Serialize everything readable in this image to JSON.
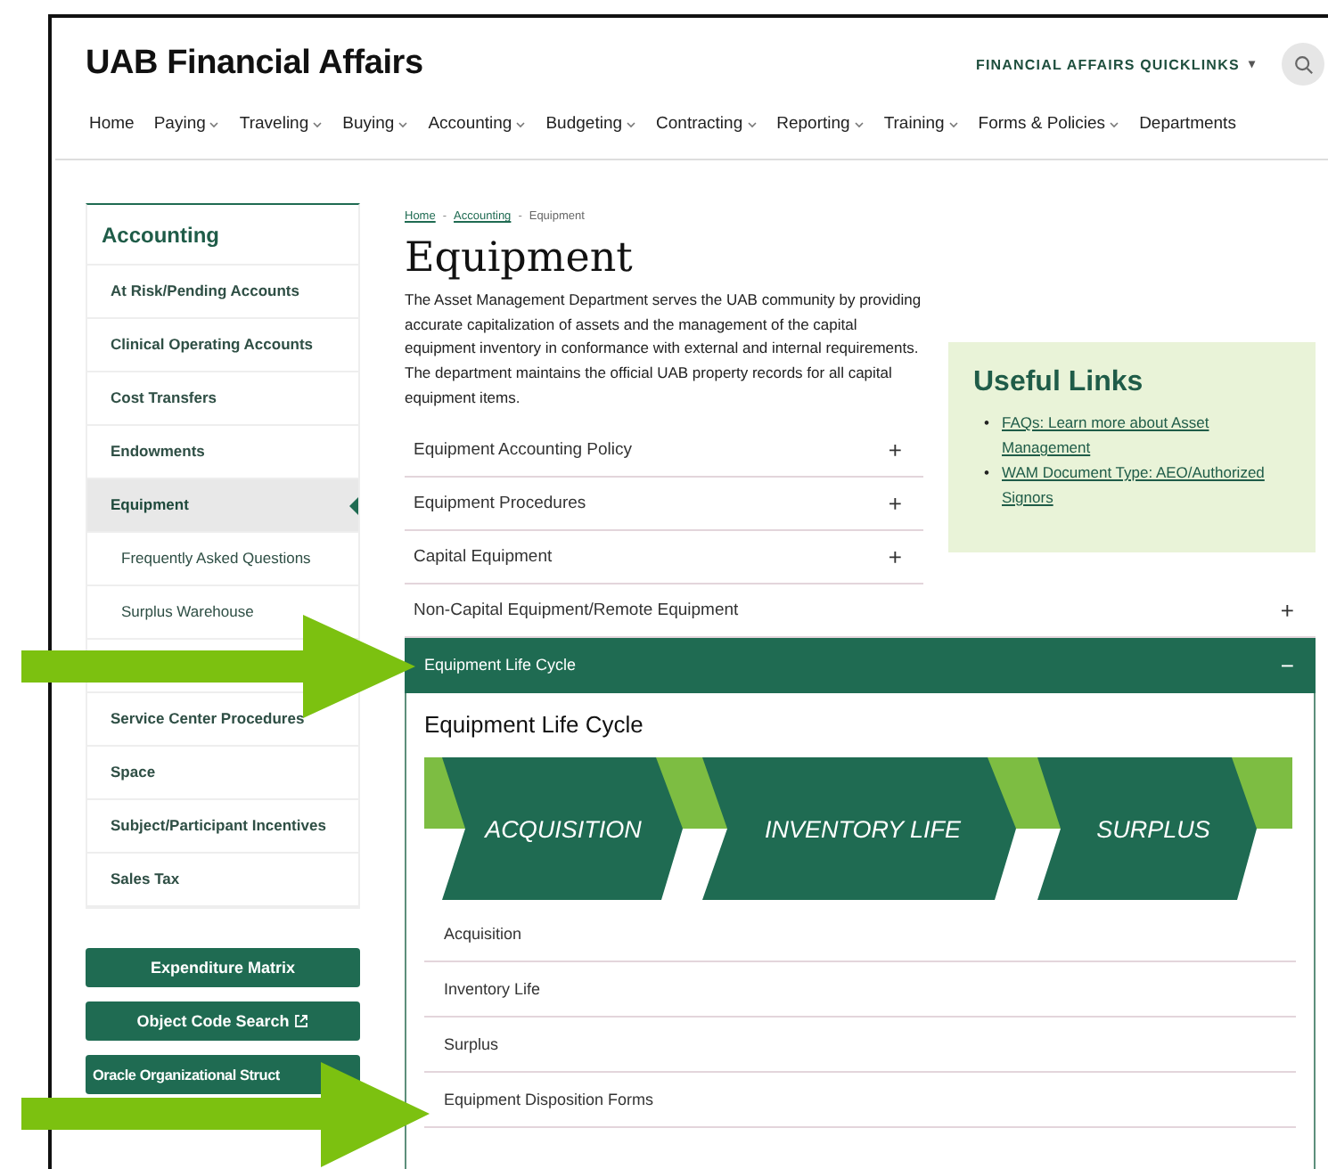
{
  "header": {
    "title": "UAB Financial Affairs",
    "quicklinks": "FINANCIAL AFFAIRS QUICKLINKS",
    "quicklinks_caret": "▾"
  },
  "nav": [
    {
      "label": "Home",
      "has_menu": false
    },
    {
      "label": "Paying",
      "has_menu": true
    },
    {
      "label": "Traveling",
      "has_menu": true
    },
    {
      "label": "Buying",
      "has_menu": true
    },
    {
      "label": "Accounting",
      "has_menu": true
    },
    {
      "label": "Budgeting",
      "has_menu": true
    },
    {
      "label": "Contracting",
      "has_menu": true
    },
    {
      "label": "Reporting",
      "has_menu": true
    },
    {
      "label": "Training",
      "has_menu": true
    },
    {
      "label": "Forms & Policies",
      "has_menu": true
    },
    {
      "label": "Departments",
      "has_menu": false
    }
  ],
  "sidebar": {
    "title": "Accounting",
    "items": [
      {
        "label": "At Risk/Pending Accounts",
        "selected": false
      },
      {
        "label": "Clinical Operating Accounts",
        "selected": false
      },
      {
        "label": "Cost Transfers",
        "selected": false
      },
      {
        "label": "Endowments",
        "selected": false
      },
      {
        "label": "Equipment",
        "selected": true,
        "children": [
          {
            "label": "Frequently Asked Questions",
            "selected": false
          },
          {
            "label": "Surplus Warehouse",
            "selected": false
          }
        ]
      },
      {
        "kind": "covered"
      },
      {
        "label": "Service Center Procedures",
        "selected": false
      },
      {
        "label": "Space",
        "selected": false
      },
      {
        "label": "Subject/Participant Incentives",
        "selected": false
      },
      {
        "label": "Sales Tax",
        "selected": false
      }
    ],
    "buttons": [
      {
        "label": "Expenditure Matrix",
        "external": false
      },
      {
        "label": "Object Code Search",
        "external": true
      },
      {
        "label": "Oracle Organizational Struct",
        "external": false
      }
    ]
  },
  "breadcrumb": [
    {
      "label": "Home",
      "kind": "link"
    },
    {
      "label": "Accounting",
      "kind": "link"
    },
    {
      "label": "Equipment",
      "kind": "current"
    }
  ],
  "breadcrumb_separator": "-",
  "page_title": "Equipment",
  "intro": "The Asset Management Department serves the UAB community by providing accurate capitalization of assets and the management of the capital equipment inventory in conformance with external and internal requirements. The department maintains the official UAB property records for all capital equipment items.",
  "useful_links": {
    "title": "Useful Links",
    "bullet": "•",
    "links": [
      "FAQs: Learn more about Asset Management",
      "WAM Document Type: AEO/Authorized Signors"
    ]
  },
  "accordion": [
    {
      "label": "Equipment Accounting Policy",
      "expanded": false,
      "toggle": "+"
    },
    {
      "label": "Equipment Procedures",
      "expanded": false,
      "toggle": "+"
    },
    {
      "label": "Capital Equipment",
      "expanded": false,
      "toggle": "+"
    },
    {
      "label": "Non-Capital Equipment/Remote Equipment",
      "expanded": false,
      "toggle": "+"
    },
    {
      "label": "Equipment Life Cycle",
      "expanded": true,
      "toggle": "−"
    }
  ],
  "life_cycle": {
    "heading": "Equipment Life Cycle",
    "stages": [
      "ACQUISITION",
      "INVENTORY LIFE",
      "SURPLUS"
    ],
    "links": [
      "Acquisition",
      "Inventory Life",
      "Surplus",
      "Equipment Disposition Forms"
    ]
  }
}
